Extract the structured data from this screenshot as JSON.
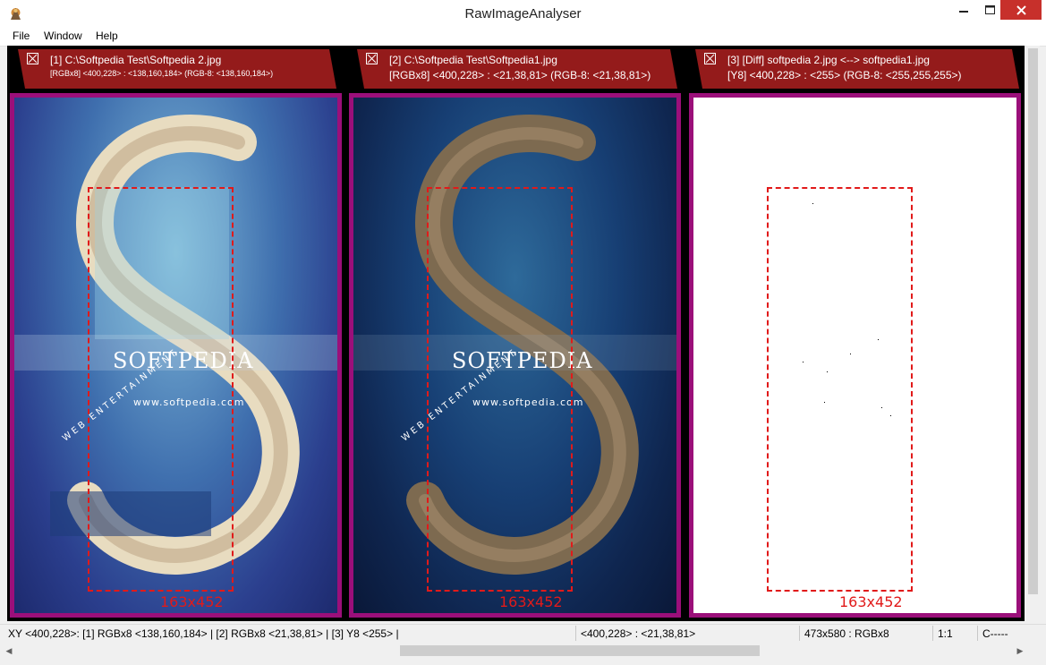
{
  "window": {
    "title": "RawImageAnalyser"
  },
  "menu": {
    "items": [
      "File",
      "Window",
      "Help"
    ]
  },
  "panels": [
    {
      "tab_line1": "[1] C:\\Softpedia Test\\Softpedia 2.jpg",
      "tab_line2": "[RGBx8] <400,228> : <138,160,184> (RGB-8: <138,160,184>)",
      "selection_label": "163x452",
      "watermark_title": "SOFTPEDIA",
      "watermark_url": "www.softpedia.com",
      "watermark_web": "WEB ENTERTAINMENT"
    },
    {
      "tab_line1": "[2] C:\\Softpedia Test\\Softpedia1.jpg",
      "tab_line2": "[RGBx8] <400,228> : <21,38,81> (RGB-8: <21,38,81>)",
      "selection_label": "163x452",
      "watermark_title": "SOFTPEDIA",
      "watermark_url": "www.softpedia.com",
      "watermark_web": "WEB ENTERTAINMENT"
    },
    {
      "tab_line1": "[3] [Diff] softpedia 2.jpg <--> softpedia1.jpg",
      "tab_line2": "[Y8] <400,228> : <255> (RGB-8: <255,255,255>)",
      "selection_label": "163x452"
    }
  ],
  "status": {
    "xy_info": "XY <400,228>: [1] RGBx8 <138,160,184> | [2] RGBx8 <21,38,81> | [3] Y8 <255> |",
    "pixel": "<400,228> : <21,38,81>",
    "size_format": "473x580 : RGBx8",
    "zoom": "1:1",
    "mode": "C-----"
  },
  "colors": {
    "tab_bg": "#941b1b",
    "frame": "#9b0f7a",
    "selection": "#e11a1a",
    "close_button": "#c7302b"
  }
}
